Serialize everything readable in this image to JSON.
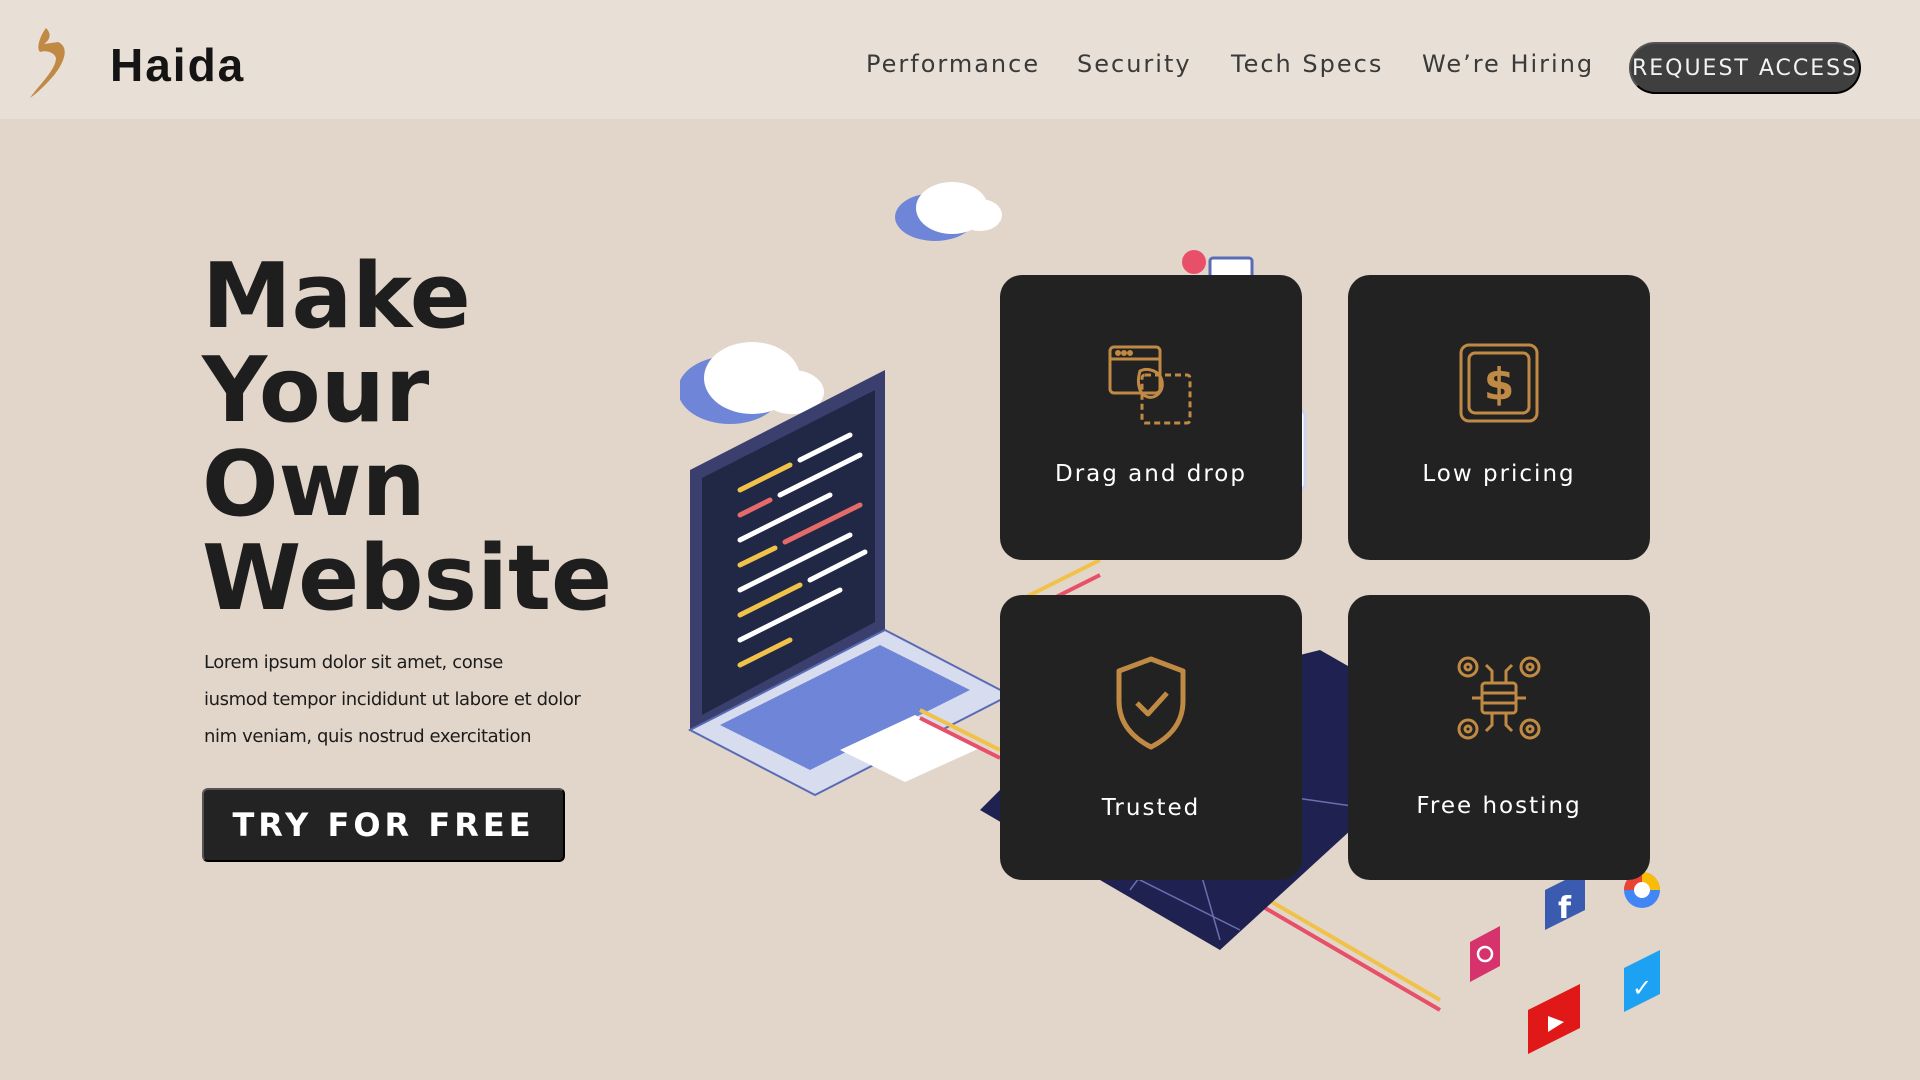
{
  "header": {
    "brand": "Haida",
    "logo_icon": "bird-logo-icon",
    "nav": [
      {
        "label": "Performance"
      },
      {
        "label": "Security"
      },
      {
        "label": "Tech Specs"
      },
      {
        "label": "We’re Hiring"
      }
    ],
    "cta_label": "REQUEST ACCESS"
  },
  "hero": {
    "headline": [
      "Make",
      "Your",
      "Own",
      "Website"
    ],
    "body_lines": [
      "Lorem ipsum dolor sit amet, conse",
      "iusmod tempor incididunt ut labore et dolor",
      "nim veniam, quis nostrud exercitation"
    ],
    "button_label": "TRY FOR FREE"
  },
  "features": [
    {
      "label": "Drag and drop",
      "icon": "drag-drop-icon"
    },
    {
      "label": "Low pricing",
      "icon": "dollar-icon"
    },
    {
      "label": "Trusted",
      "icon": "shield-check-icon"
    },
    {
      "label": "Free hosting",
      "icon": "server-gears-icon"
    }
  ],
  "colors": {
    "page_background": "#e2d6ca",
    "header_background": "#e8e0d6",
    "card_background": "#222222",
    "icon_gold": "#c08a45",
    "button_dark": "#232323"
  }
}
